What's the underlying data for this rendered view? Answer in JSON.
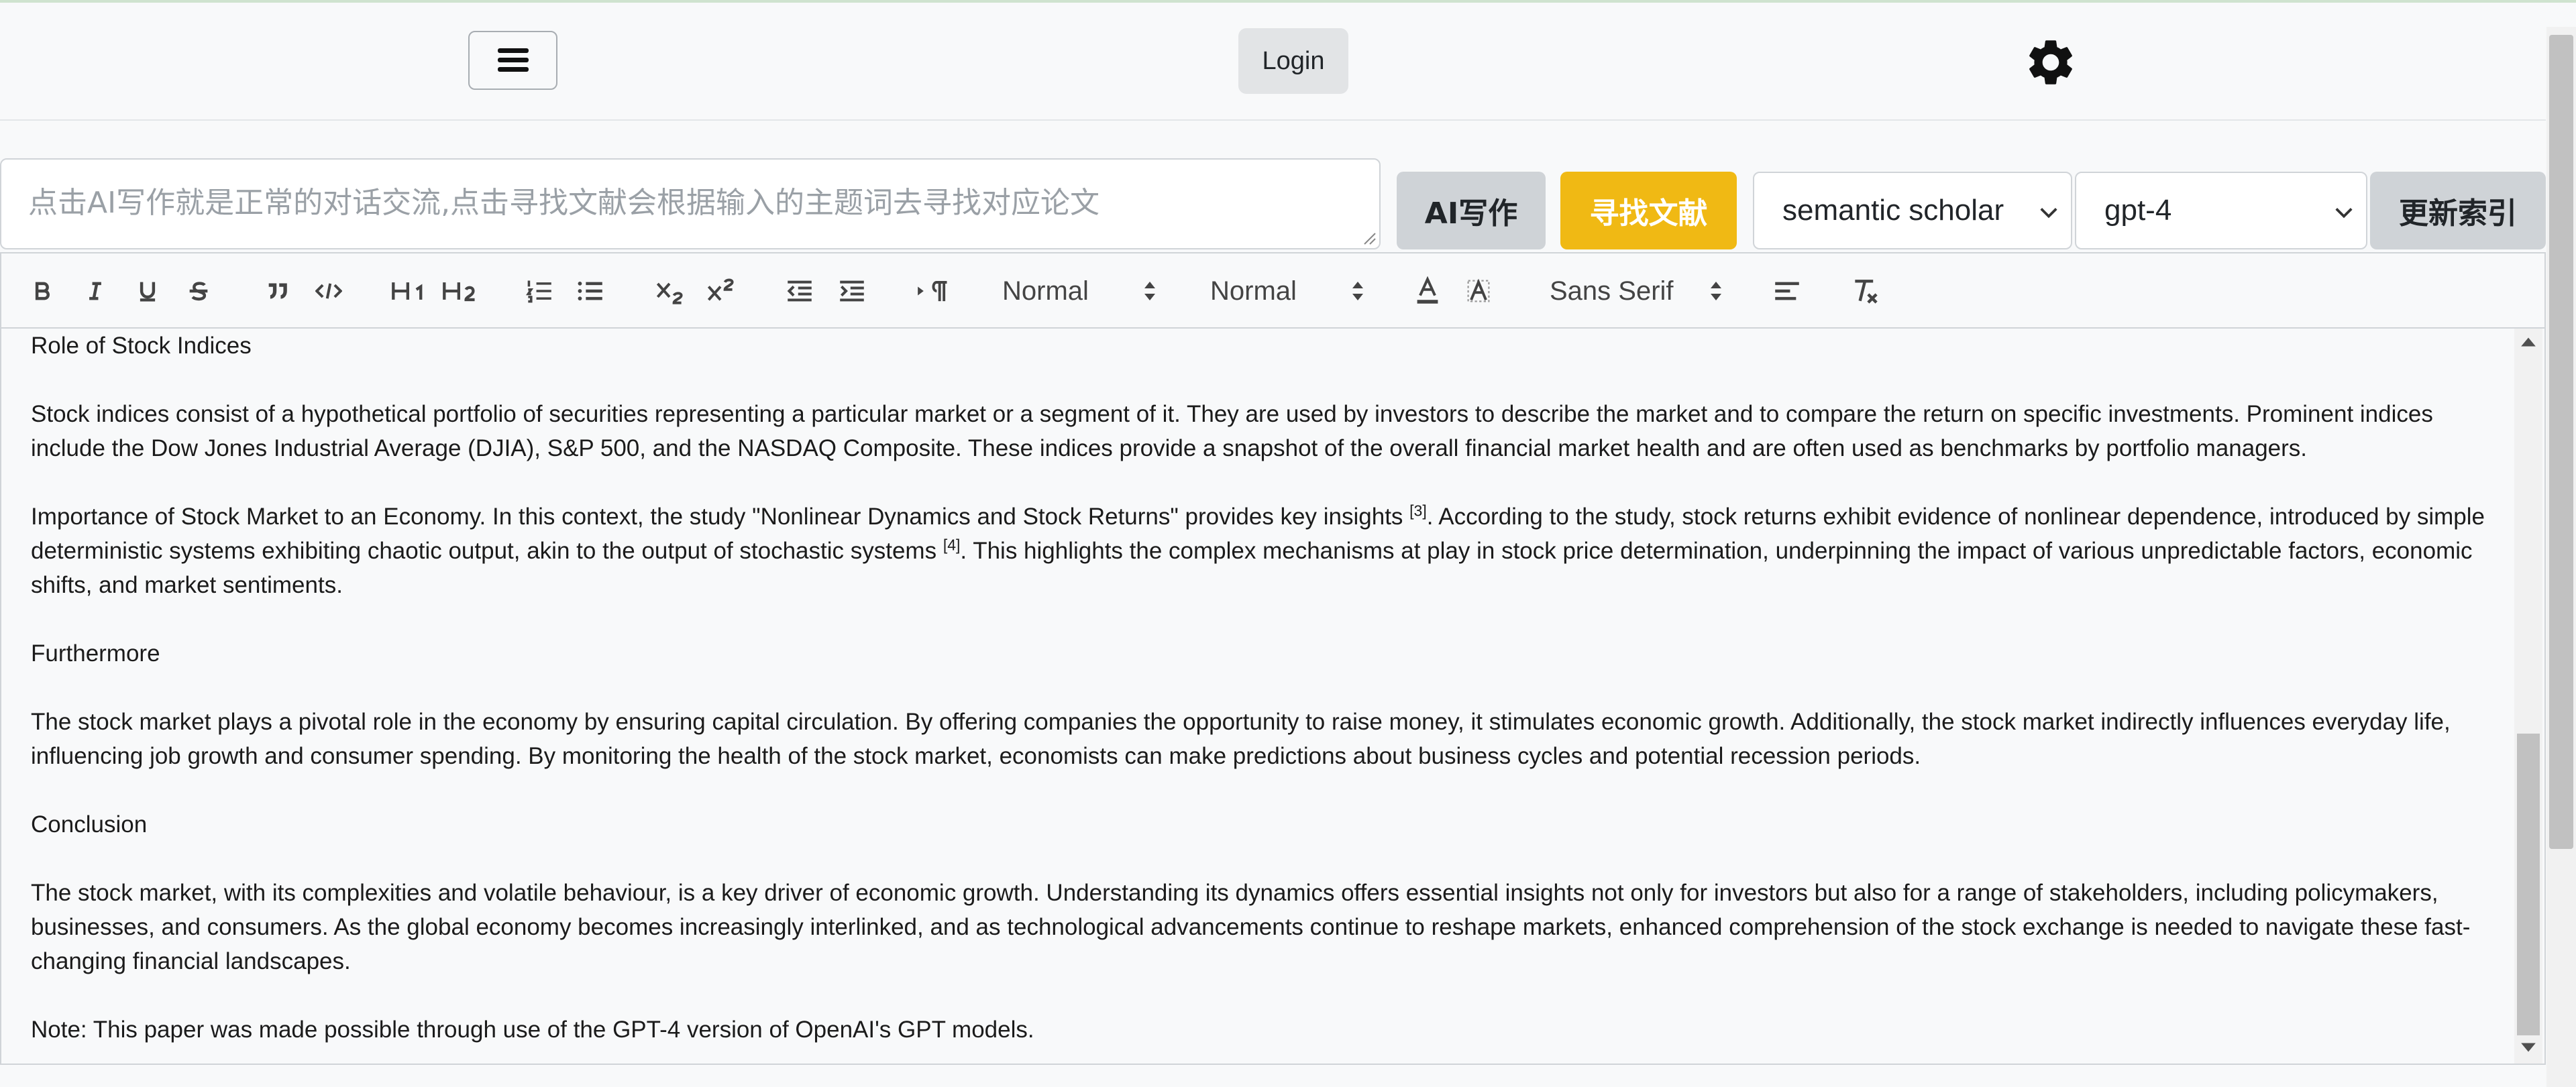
{
  "navbar": {
    "menu_icon": "hamburger-menu-icon",
    "login_label": "Login",
    "settings_icon": "gear-icon"
  },
  "query": {
    "placeholder": "点击AI写作就是正常的对话交流,点击寻找文献会根据输入的主题词去寻找对应论文",
    "ai_write_label": "AI写作",
    "find_papers_label": "寻找文献",
    "source_selected": "semantic scholar",
    "model_selected": "gpt-4",
    "update_index_label": "更新索引"
  },
  "toolbar": {
    "icons": [
      "bold-icon",
      "italic-icon",
      "underline-icon",
      "strikethrough-icon",
      "blockquote-icon",
      "code-block-icon",
      "header1-icon",
      "header2-icon",
      "ordered-list-icon",
      "bullet-list-icon",
      "subscript-icon",
      "superscript-icon",
      "outdent-icon",
      "indent-icon",
      "text-direction-icon",
      "text-color-icon",
      "background-color-icon",
      "align-left-icon",
      "clear-format-icon"
    ],
    "size_value": "Normal",
    "header_value": "Normal",
    "font_value": "Sans Serif"
  },
  "colors": {
    "find_button": "#f0b914",
    "gray_button": "#cfd3d7",
    "page_bg": "#f8f9fa"
  },
  "editor": {
    "h_role": "Role of Stock Indices",
    "p_indices": "Stock indices consist of a hypothetical portfolio of securities representing a particular market or a segment of it. They are used by investors to describe the market and to compare the return on specific investments. Prominent indices include the Dow Jones Industrial Average (DJIA), S&P 500, and the NASDAQ Composite. These indices provide a snapshot of the overall financial market health and are often used as benchmarks by portfolio managers.",
    "p_importance_1": "Importance of Stock Market to an Economy. In this context, the study \"Nonlinear Dynamics and Stock Returns\" provides key insights ",
    "cite_3": "[3]",
    "p_importance_2": ". According to the study, stock returns exhibit evidence of nonlinear dependence, introduced by simple deterministic systems exhibiting chaotic output, akin to the output of stochastic systems ",
    "cite_4": "[4]",
    "p_importance_3": ". This highlights the complex mechanisms at play in stock price determination, underpinning the impact of various unpredictable factors, economic shifts, and market sentiments.",
    "h_furthermore": "Furthermore",
    "p_role": "The stock market plays a pivotal role in the economy by ensuring capital circulation. By offering companies the opportunity to raise money, it stimulates economic growth. Additionally, the stock market indirectly influences everyday life, influencing job growth and consumer spending. By monitoring the health of the stock market, economists can make predictions about business cycles and potential recession periods.",
    "h_conclusion": "Conclusion",
    "p_conclusion": "The stock market, with its complexities and volatile behaviour, is a key driver of economic growth. Understanding its dynamics offers essential insights not only for investors but also for a range of stakeholders, including policymakers, businesses, and consumers. As the global economy becomes increasingly interlinked, and as technological advancements continue to reshape markets, enhanced comprehension of the stock exchange is needed to navigate these fast-changing financial landscapes.",
    "p_note": "Note: This paper was made possible through use of the GPT-4 version of OpenAI's GPT models."
  }
}
